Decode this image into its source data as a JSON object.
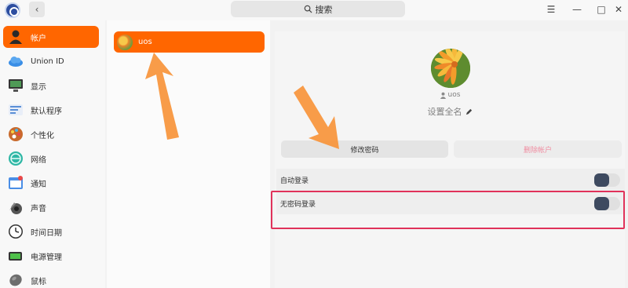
{
  "titlebar": {
    "search_label": "搜索",
    "back_glyph": "‹",
    "menu_glyph": "☰",
    "minimize_glyph": "—",
    "maximize_glyph": "□",
    "close_glyph": "✕"
  },
  "sidebar": {
    "items": [
      {
        "label": "帐户",
        "icon": "account-icon",
        "active": true
      },
      {
        "label": "Union ID",
        "icon": "cloud-icon"
      },
      {
        "label": "显示",
        "icon": "monitor-icon"
      },
      {
        "label": "默认程序",
        "icon": "default-apps-icon"
      },
      {
        "label": "个性化",
        "icon": "palette-icon"
      },
      {
        "label": "网络",
        "icon": "network-icon"
      },
      {
        "label": "通知",
        "icon": "notification-icon"
      },
      {
        "label": "声音",
        "icon": "speaker-icon"
      },
      {
        "label": "时间日期",
        "icon": "clock-icon"
      },
      {
        "label": "电源管理",
        "icon": "battery-icon"
      },
      {
        "label": "鼠标",
        "icon": "mouse-icon"
      }
    ]
  },
  "users": [
    {
      "name": "uos",
      "selected": true
    }
  ],
  "detail": {
    "username": "uos",
    "fullname_placeholder": "设置全名",
    "change_password_label": "修改密码",
    "delete_account_label": "删除帐户",
    "auto_login_label": "自动登录",
    "auto_login_enabled": false,
    "passwordless_login_label": "无密码登录",
    "passwordless_login_enabled": false
  },
  "colors": {
    "accent": "#ff6600",
    "highlight": "#e0325a",
    "arrow": "#f7943a"
  }
}
